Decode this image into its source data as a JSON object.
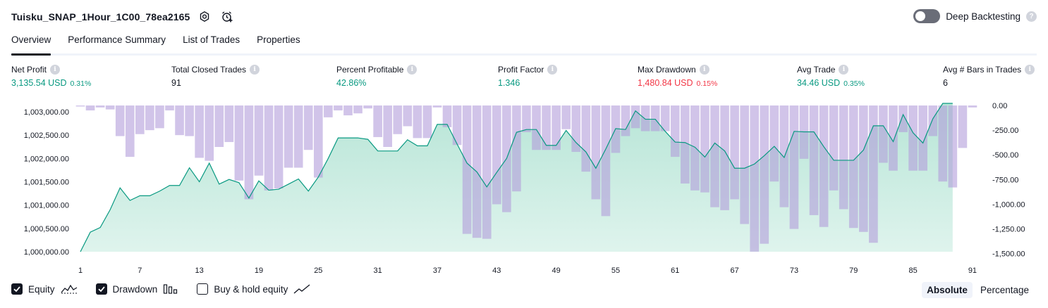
{
  "header": {
    "title": "Tuisku_SNAP_1Hour_1C00_78ea2165",
    "settings_icon": "gear-icon",
    "alert_icon": "alarm-clock-plus-icon"
  },
  "deep_backtesting": {
    "label": "Deep Backtesting",
    "enabled": false,
    "help": "?"
  },
  "tabs": [
    {
      "label": "Overview",
      "active": true
    },
    {
      "label": "Performance Summary",
      "active": false
    },
    {
      "label": "List of Trades",
      "active": false
    },
    {
      "label": "Properties",
      "active": false
    }
  ],
  "metrics": [
    {
      "label": "Net Profit",
      "value": "3,135.54 USD",
      "pct": "0.31%",
      "tone": "pos"
    },
    {
      "label": "Total Closed Trades",
      "value": "91",
      "pct": "",
      "tone": "neutral"
    },
    {
      "label": "Percent Profitable",
      "value": "42.86%",
      "pct": "",
      "tone": "pos"
    },
    {
      "label": "Profit Factor",
      "value": "1.346",
      "pct": "",
      "tone": "pos"
    },
    {
      "label": "Max Drawdown",
      "value": "1,480.84 USD",
      "pct": "0.15%",
      "tone": "neg"
    },
    {
      "label": "Avg Trade",
      "value": "34.46 USD",
      "pct": "0.35%",
      "tone": "pos"
    },
    {
      "label": "Avg # Bars in Trades",
      "value": "6",
      "pct": "",
      "tone": "neutral"
    }
  ],
  "info_glyph": "i",
  "chart_data": {
    "type": "line",
    "x_ticks": [
      "1",
      "7",
      "13",
      "19",
      "25",
      "31",
      "37",
      "43",
      "49",
      "55",
      "61",
      "67",
      "73",
      "79",
      "85",
      "91"
    ],
    "y_left_ticks": [
      "1,000,000.00",
      "1,000,500.00",
      "1,001,000.00",
      "1,001,500.00",
      "1,002,000.00",
      "1,002,500.00",
      "1,003,000.00"
    ],
    "y_left_range": [
      1000000,
      1003135
    ],
    "y_right_ticks": [
      "0.00",
      "-250.00",
      "-500.00",
      "-750.00",
      "-1,000.00",
      "-1,250.00",
      "-1,500.00"
    ],
    "y_right_range": [
      -1480.84,
      0
    ],
    "x_range": [
      1,
      92
    ],
    "series": [
      {
        "name": "Equity",
        "color": "#089981",
        "values": [
          1000000,
          1000420,
          1000520,
          1000900,
          1001370,
          1001100,
          1001200,
          1001200,
          1001300,
          1001420,
          1001420,
          1001800,
          1001500,
          1001900,
          1001450,
          1001550,
          1001480,
          1001150,
          1001520,
          1001320,
          1001340,
          1001450,
          1001560,
          1001300,
          1001600,
          1002000,
          1002440,
          1002440,
          1002440,
          1002410,
          1002160,
          1002160,
          1002160,
          1002400,
          1002270,
          1002270,
          1002730,
          1002730,
          1002310,
          1001900,
          1001710,
          1001390,
          1001700,
          1002000,
          1002560,
          1002620,
          1002620,
          1002280,
          1002280,
          1002600,
          1002340,
          1002140,
          1001790,
          1002200,
          1002640,
          1002620,
          1003020,
          1002840,
          1002840,
          1002580,
          1002350,
          1002340,
          1002240,
          1002030,
          1002330,
          1002160,
          1001790,
          1001790,
          1001880,
          1002060,
          1002260,
          1002020,
          1002580,
          1002570,
          1002570,
          1002250,
          1001960,
          1001960,
          1001960,
          1002180,
          1002700,
          1002700,
          1002360,
          1002940,
          1002550,
          1002330,
          1002850,
          1003180,
          1003180
        ]
      },
      {
        "name": "Drawdown",
        "color": "#b39ddb",
        "values": [
          -10,
          -50,
          -20,
          -40,
          -310,
          -520,
          -290,
          -250,
          -230,
          -50,
          -300,
          -310,
          -530,
          -560,
          -420,
          -370,
          -760,
          -950,
          -710,
          -860,
          -840,
          -630,
          -630,
          -450,
          -730,
          -120,
          -50,
          -100,
          -80,
          -30,
          -320,
          -420,
          -290,
          -210,
          -330,
          -330,
          -20,
          -220,
          -400,
          -1300,
          -1340,
          -1350,
          -1000,
          -1080,
          -870,
          -270,
          -450,
          -450,
          -450,
          -240,
          -470,
          -670,
          -950,
          -1120,
          -480,
          -310,
          -230,
          -260,
          -260,
          -260,
          -520,
          -790,
          -860,
          -880,
          -1030,
          -1060,
          -950,
          -1200,
          -1480,
          -1400,
          -770,
          -1030,
          -1250,
          -540,
          -1110,
          -1230,
          -860,
          -1050,
          -1240,
          -1280,
          -1390,
          -580,
          -660,
          -270,
          -660,
          -660,
          -310,
          -770,
          -830,
          -430,
          -20
        ]
      }
    ]
  },
  "footer": {
    "items": [
      {
        "label": "Equity",
        "checked": true,
        "icon": "equity-line-icon"
      },
      {
        "label": "Drawdown",
        "checked": true,
        "icon": "drawdown-bars-icon"
      },
      {
        "label": "Buy & hold equity",
        "checked": false,
        "icon": "buy-hold-line-icon"
      }
    ],
    "modes": [
      {
        "label": "Absolute",
        "active": true
      },
      {
        "label": "Percentage",
        "active": false
      }
    ]
  }
}
